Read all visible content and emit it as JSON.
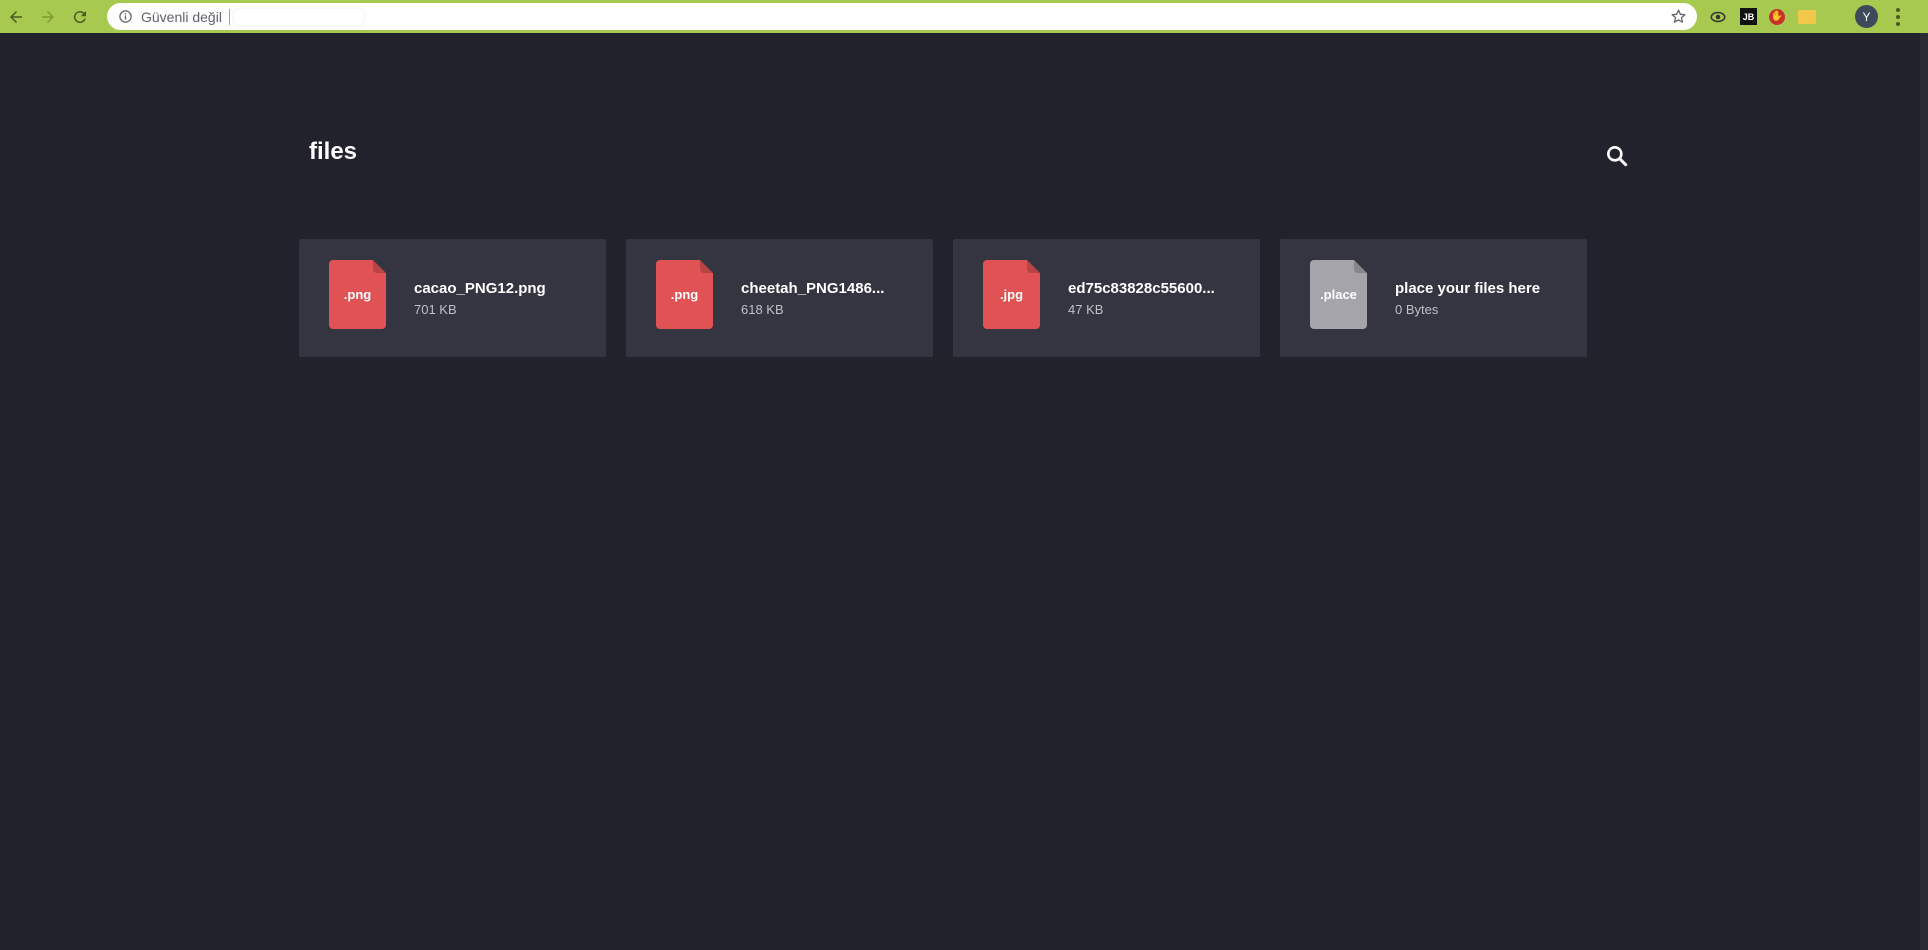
{
  "browser": {
    "security_label": "Güvenli değil",
    "profile_initial": "Y",
    "extensions": [
      {
        "name": "eye-extension-icon"
      },
      {
        "name": "jb-extension",
        "label": "JB"
      },
      {
        "name": "stop-extension-icon"
      },
      {
        "name": "folder-extension-icon"
      }
    ]
  },
  "page": {
    "title": "files"
  },
  "files": [
    {
      "ext": ".png",
      "name": "cacao_PNG12.png",
      "size": "701 KB",
      "color": "#e05254"
    },
    {
      "ext": ".png",
      "name": "cheetah_PNG1486...",
      "size": "618 KB",
      "color": "#e05254"
    },
    {
      "ext": ".jpg",
      "name": "ed75c83828c55600...",
      "size": "47 KB",
      "color": "#e05254"
    },
    {
      "ext": ".place",
      "name": "place your files here",
      "size": "0 Bytes",
      "color": "#a4a4aa"
    }
  ]
}
